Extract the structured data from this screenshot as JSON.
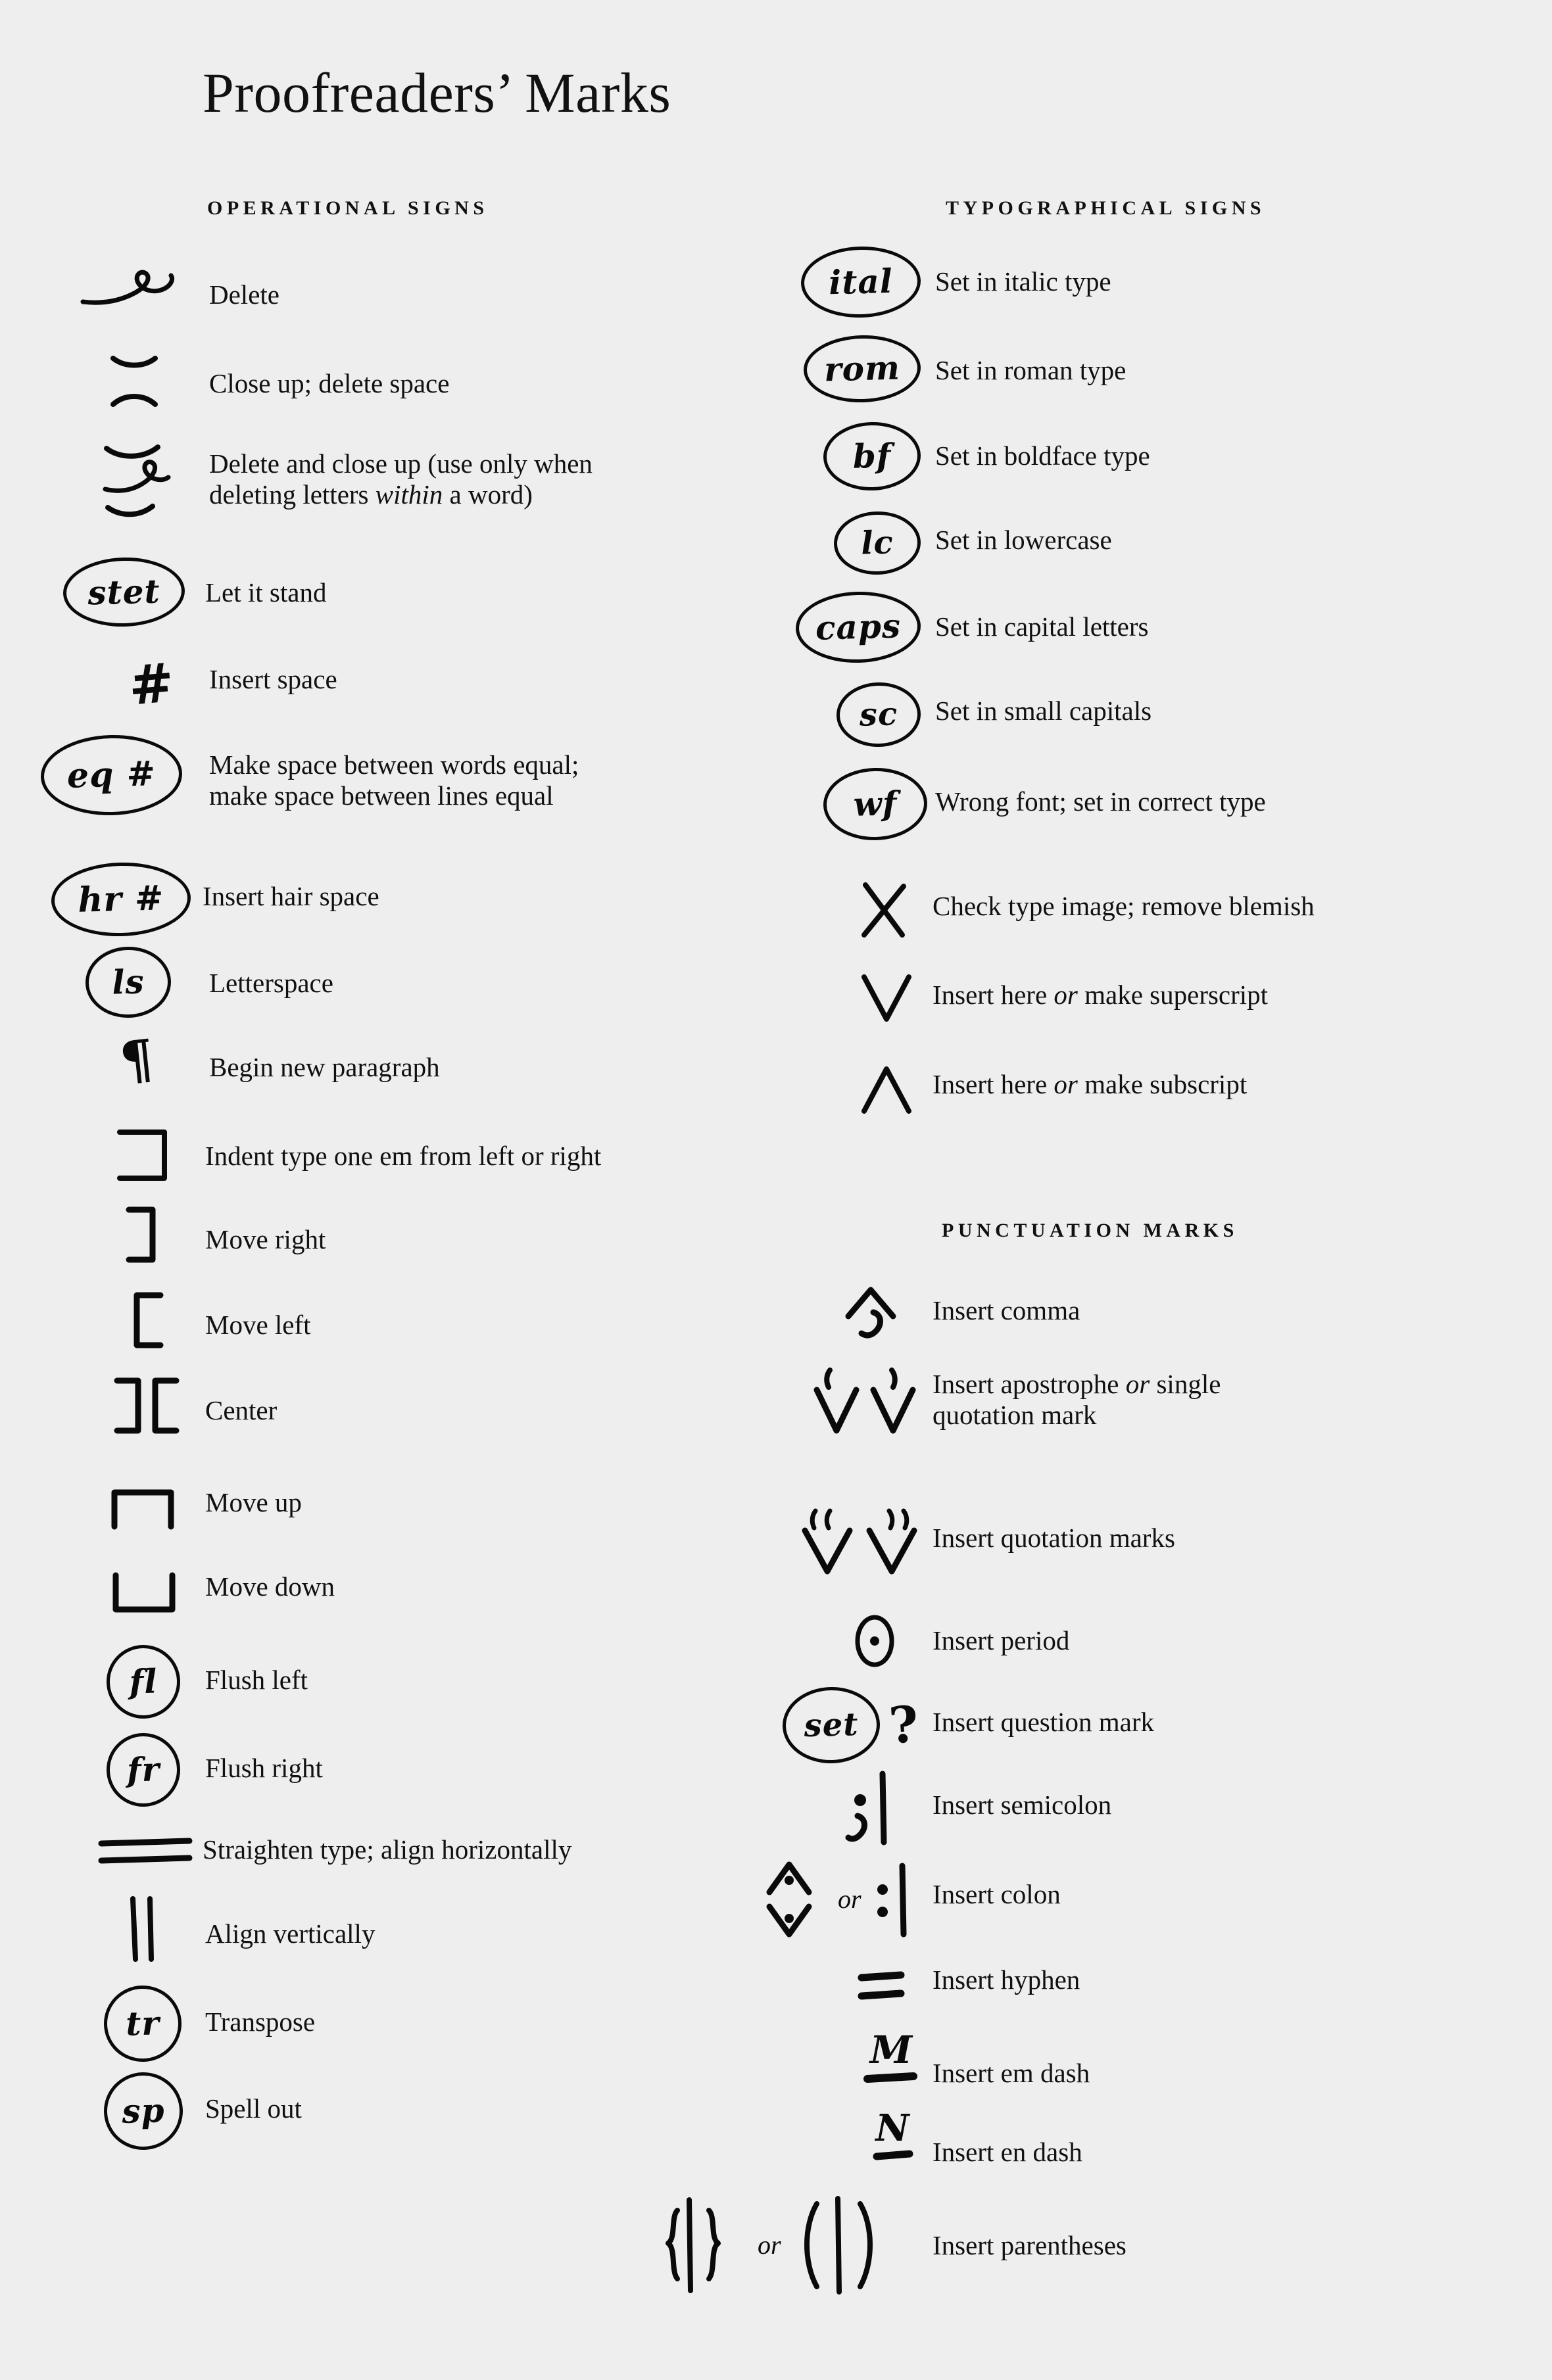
{
  "page": {
    "title": "Proofreaders’ Marks",
    "background_color": "#eeeeee",
    "ink_color": "#0a0a0a"
  },
  "sections": {
    "operational": {
      "heading": "OPERATIONAL SIGNS"
    },
    "typographical": {
      "heading": "TYPOGRAPHICAL SIGNS"
    },
    "punctuation": {
      "heading": "PUNCTUATION MARKS"
    }
  },
  "operational_signs": [
    {
      "mark": "delete-dele-loop",
      "description": "Delete"
    },
    {
      "mark": "close-up-arcs",
      "description": "Close up; delete space"
    },
    {
      "mark": "delete-and-close-up",
      "description_line1": "Delete and close up (use only when",
      "description_line2_pre": "deleting letters ",
      "description_line2_em": "within",
      "description_line2_post": " a word)"
    },
    {
      "mark": "circled-stet",
      "mark_text": "stet",
      "description": "Let it stand"
    },
    {
      "mark": "hash-insert-space",
      "mark_text": "#",
      "description": "Insert space"
    },
    {
      "mark": "circled-eq-hash",
      "mark_text": "eq #",
      "description_line1": "Make space between words equal;",
      "description_line2": "make space between lines equal"
    },
    {
      "mark": "circled-hr-hash",
      "mark_text": "hr #",
      "description": "Insert hair space"
    },
    {
      "mark": "circled-ls",
      "mark_text": "ls",
      "description": "Letterspace"
    },
    {
      "mark": "pilcrow",
      "mark_text": "¶",
      "description": "Begin new paragraph"
    },
    {
      "mark": "indent-em-box",
      "description": "Indent type one em from left or right"
    },
    {
      "mark": "move-right-bracket",
      "mark_text": "]",
      "description": "Move right"
    },
    {
      "mark": "move-left-bracket",
      "mark_text": "[",
      "description": "Move left"
    },
    {
      "mark": "center-brackets",
      "mark_text": "][",
      "description": "Center"
    },
    {
      "mark": "move-up-bracket",
      "description": "Move up"
    },
    {
      "mark": "move-down-bracket",
      "description": "Move down"
    },
    {
      "mark": "circled-fl",
      "mark_text": "fl",
      "description": "Flush left"
    },
    {
      "mark": "circled-fr",
      "mark_text": "fr",
      "description": "Flush right"
    },
    {
      "mark": "double-rule-horizontal",
      "description": "Straighten type; align horizontally"
    },
    {
      "mark": "double-rule-vertical",
      "description": "Align vertically"
    },
    {
      "mark": "circled-tr",
      "mark_text": "tr",
      "description": "Transpose"
    },
    {
      "mark": "circled-sp",
      "mark_text": "sp",
      "description": "Spell out"
    }
  ],
  "typographical_signs": [
    {
      "mark": "circled-ital",
      "mark_text": "ital",
      "description": "Set in italic type"
    },
    {
      "mark": "circled-rom",
      "mark_text": "rom",
      "description": "Set in roman type"
    },
    {
      "mark": "circled-bf",
      "mark_text": "bf",
      "description": "Set in boldface type"
    },
    {
      "mark": "circled-lc",
      "mark_text": "lc",
      "description": "Set in lowercase"
    },
    {
      "mark": "circled-caps",
      "mark_text": "caps",
      "description": "Set in capital letters"
    },
    {
      "mark": "circled-sc",
      "mark_text": "sc",
      "description": "Set in small capitals"
    },
    {
      "mark": "circled-wf",
      "mark_text": "wf",
      "description": "Wrong font; set in correct type"
    },
    {
      "mark": "x-mark",
      "mark_text": "X",
      "description": "Check type image; remove blemish"
    },
    {
      "mark": "caret-down-superscript",
      "mark_text": "V",
      "description_pre": "Insert here ",
      "description_em": "or",
      "description_post": " make superscript"
    },
    {
      "mark": "caret-up-subscript",
      "mark_text": "Λ",
      "description_pre": "Insert here ",
      "description_em": "or",
      "description_post": " make subscript"
    }
  ],
  "punctuation_marks": [
    {
      "mark": "caret-with-comma",
      "description": "Insert comma"
    },
    {
      "mark": "carets-with-apostrophes",
      "description_line1_pre": "Insert apostrophe ",
      "description_line1_em": "or",
      "description_line1_post": " single",
      "description_line2": "quotation mark"
    },
    {
      "mark": "carets-with-quotes",
      "description": "Insert quotation marks"
    },
    {
      "mark": "circled-period-dot",
      "description": "Insert period"
    },
    {
      "mark": "circled-set-question",
      "mark_text": "set",
      "mark_extra": "?",
      "description": "Insert question mark"
    },
    {
      "mark": "semicolon-with-rule",
      "description": "Insert semicolon"
    },
    {
      "mark": "colon-caret-or-colon-rule",
      "or_label": "or",
      "description": "Insert colon"
    },
    {
      "mark": "double-hyphen",
      "description": "Insert hyphen"
    },
    {
      "mark": "em-dash-with-M",
      "mark_text": "M",
      "description": "Insert em dash"
    },
    {
      "mark": "en-dash-with-N",
      "mark_text": "N",
      "description": "Insert en dash"
    },
    {
      "mark": "braces-or-parens",
      "or_label": "or",
      "description": "Insert parentheses"
    }
  ]
}
